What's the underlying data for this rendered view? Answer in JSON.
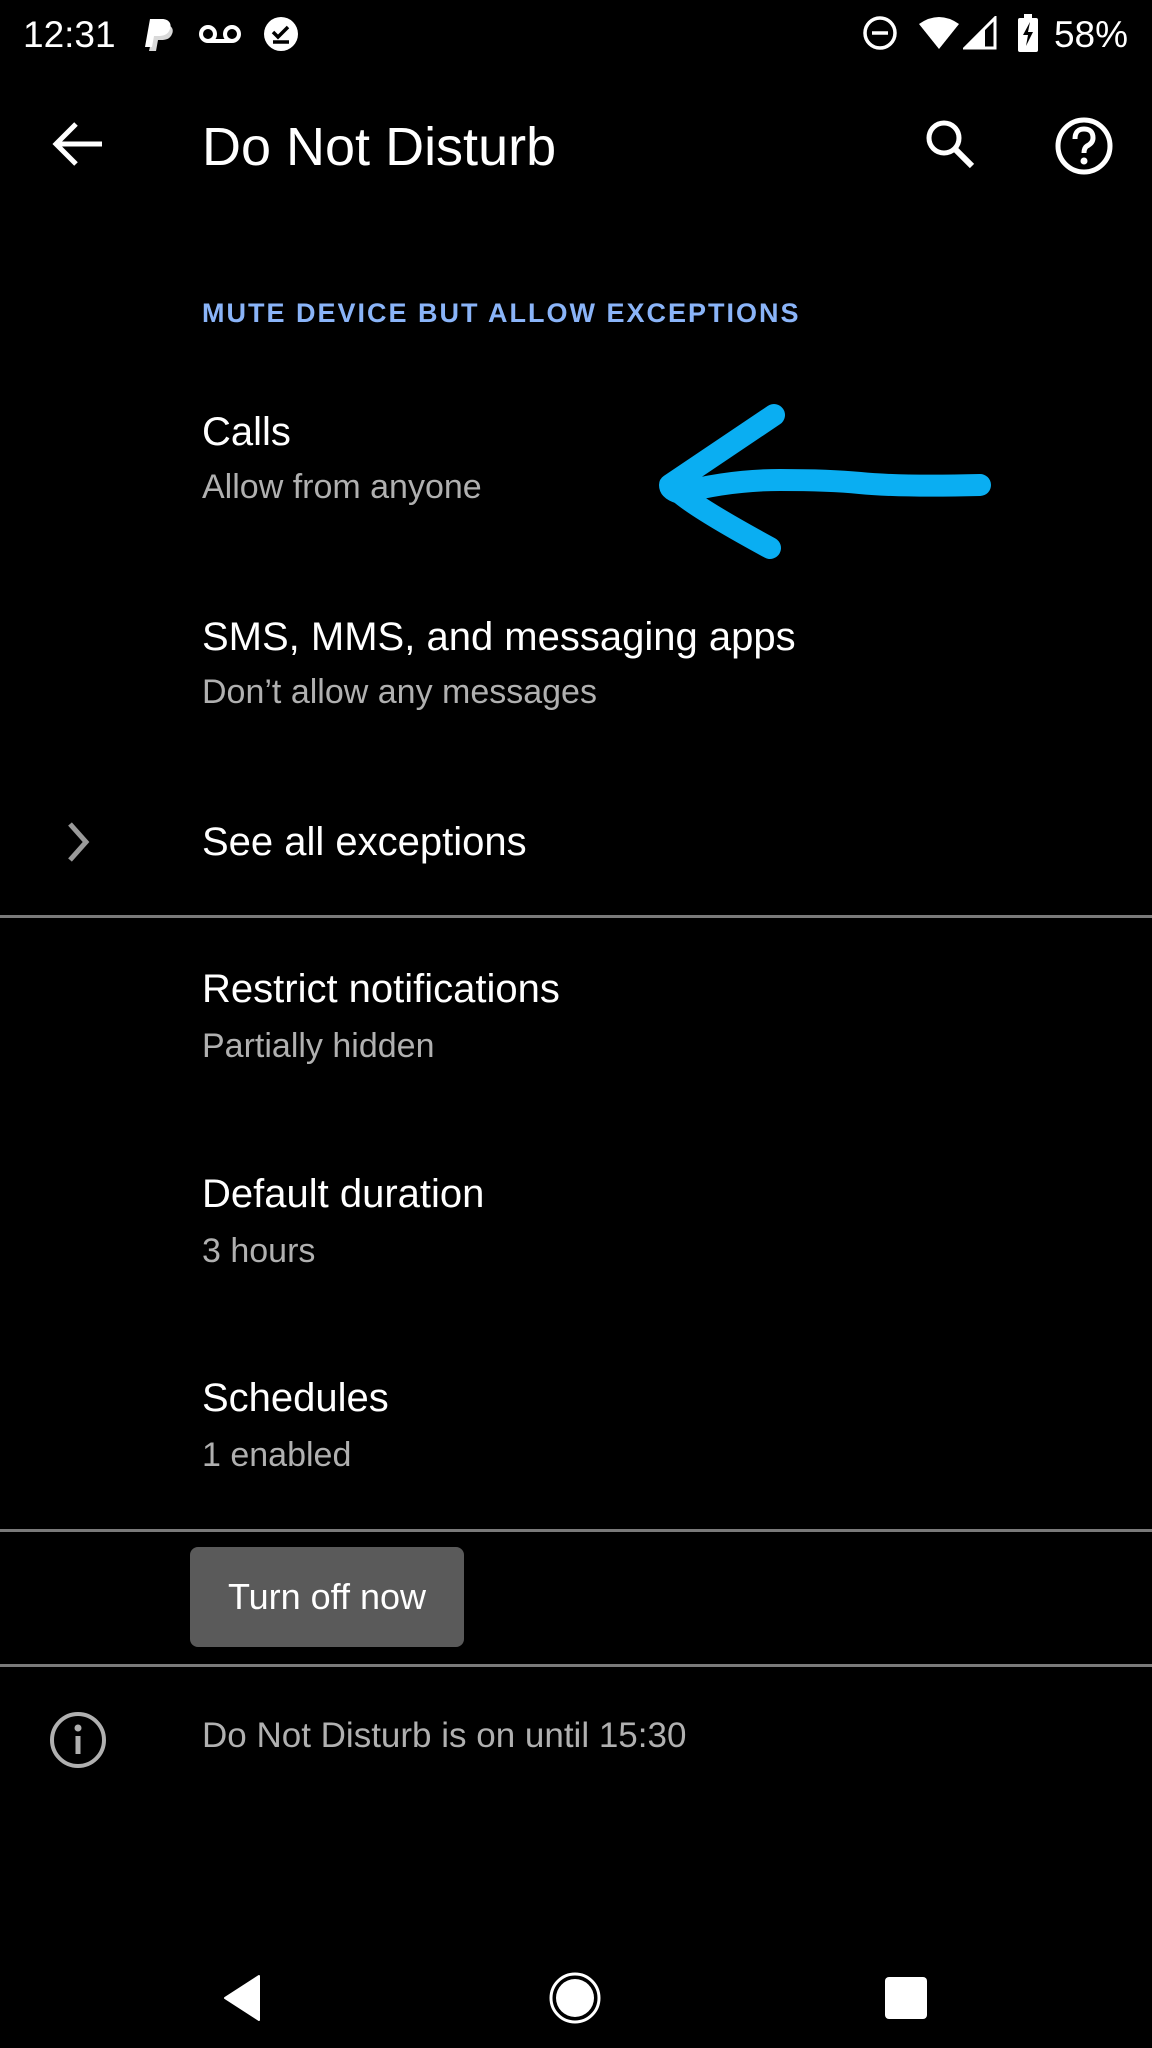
{
  "status_bar": {
    "time": "12:31",
    "left_icons": [
      "paypal-icon",
      "voicemail-icon",
      "download-done-icon"
    ],
    "right_icons": [
      "do-not-disturb-icon",
      "wifi-icon",
      "cell-signal-icon",
      "battery-charging-icon"
    ],
    "battery_percent": "58%"
  },
  "app_bar": {
    "title": "Do Not Disturb",
    "back_icon": "arrow-back-icon",
    "search_icon": "search-icon",
    "help_icon": "help-icon"
  },
  "section": {
    "header": "MUTE DEVICE BUT ALLOW EXCEPTIONS",
    "items": [
      {
        "title": "Calls",
        "summary": "Allow from anyone"
      },
      {
        "title": "SMS, MMS, and messaging apps",
        "summary": "Don’t allow any messages"
      },
      {
        "title": "See all exceptions"
      }
    ]
  },
  "settings": {
    "items": [
      {
        "title": "Restrict notifications",
        "summary": "Partially hidden"
      },
      {
        "title": "Default duration",
        "summary": "3 hours"
      },
      {
        "title": "Schedules",
        "summary": "1 enabled"
      }
    ]
  },
  "action": {
    "turn_off_label": "Turn off now"
  },
  "footer": {
    "info_icon": "info-icon",
    "text": "Do Not Disturb is on until 15:30"
  },
  "annotation": {
    "type": "hand-drawn arrow pointing left at Calls",
    "color": "#0aaef2"
  },
  "nav_bar": {
    "buttons": [
      "back-triangle-icon",
      "home-circle-icon",
      "recents-square-icon"
    ]
  },
  "colors": {
    "accent": "#8ab4f8",
    "background": "#000000",
    "button_bg": "#5a5a5a",
    "summary_text": "#b0b0b0"
  }
}
